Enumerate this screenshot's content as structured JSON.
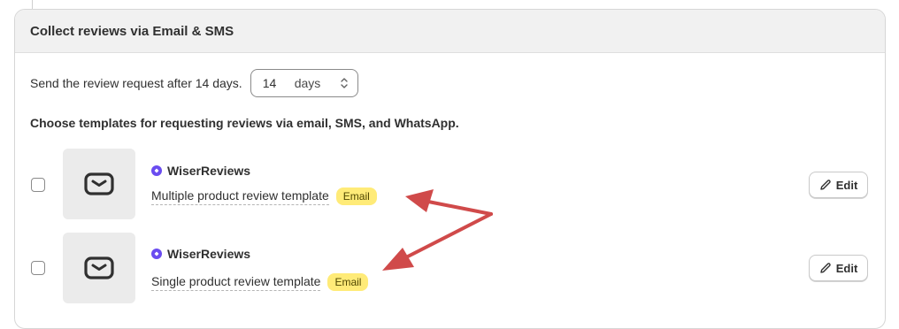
{
  "card": {
    "title": "Collect reviews via Email & SMS"
  },
  "send": {
    "label": "Send the review request after 14 days.",
    "days_value": "14",
    "days_unit": "days"
  },
  "templates_intro": "Choose templates for requesting reviews via email, SMS, and WhatsApp.",
  "templates": [
    {
      "brand": "WiserReviews",
      "name": "Multiple product review template",
      "badge": "Email",
      "edit_label": "Edit",
      "icon": "mail-icon"
    },
    {
      "brand": "WiserReviews",
      "name": "Single product review template",
      "badge": "Email",
      "edit_label": "Edit",
      "icon": "mail-icon"
    }
  ],
  "colors": {
    "badge_bg": "#ffeb78",
    "brand_icon": "#6a4cf0",
    "annotation_arrow": "#d04a4a"
  }
}
